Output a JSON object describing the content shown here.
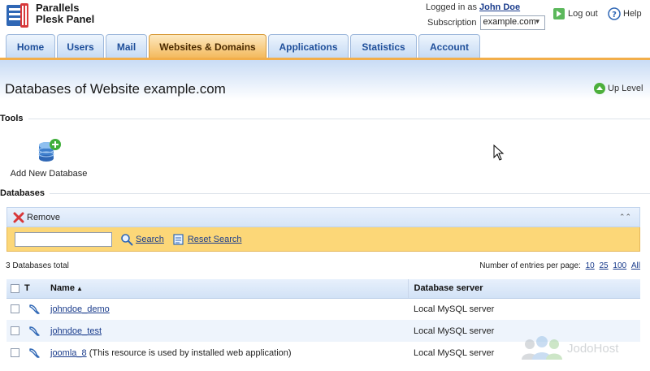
{
  "header": {
    "brand_line1": "Parallels",
    "brand_line2": "Plesk Panel",
    "logged_in_label": "Logged in as",
    "user_name": "John Doe",
    "subscription_label": "Subscription",
    "subscription_value": "example.com",
    "logout_label": "Log out",
    "help_label": "Help"
  },
  "tabs": [
    {
      "label": "Home"
    },
    {
      "label": "Users"
    },
    {
      "label": "Mail"
    },
    {
      "label": "Websites & Domains"
    },
    {
      "label": "Applications"
    },
    {
      "label": "Statistics"
    },
    {
      "label": "Account"
    }
  ],
  "page": {
    "title": "Databases of Website example.com",
    "up_level_label": "Up Level"
  },
  "tools": {
    "heading": "Tools",
    "add_database_label": "Add New Database"
  },
  "databases": {
    "heading": "Databases",
    "remove_label": "Remove",
    "search_placeholder": "",
    "search_label": "Search",
    "reset_search_label": "Reset Search",
    "total_label": "3 Databases total",
    "per_page_label": "Number of entries per page:",
    "per_page_options": [
      "10",
      "25",
      "100",
      "All"
    ],
    "columns": {
      "type": "T",
      "name": "Name",
      "server": "Database server"
    },
    "rows": [
      {
        "name": "johndoe_demo",
        "note": "",
        "server": "Local MySQL server"
      },
      {
        "name": "johndoe_test",
        "note": "",
        "server": "Local MySQL server"
      },
      {
        "name": "joomla_8",
        "note": "(This resource is used by installed web application)",
        "server": "Local MySQL server"
      }
    ]
  },
  "watermark": {
    "text": "JodoHost"
  },
  "colors": {
    "active_tab": "#f3b85a",
    "tab": "#c5daf4",
    "search_bar": "#fcd778",
    "link": "#1a3c8c"
  }
}
